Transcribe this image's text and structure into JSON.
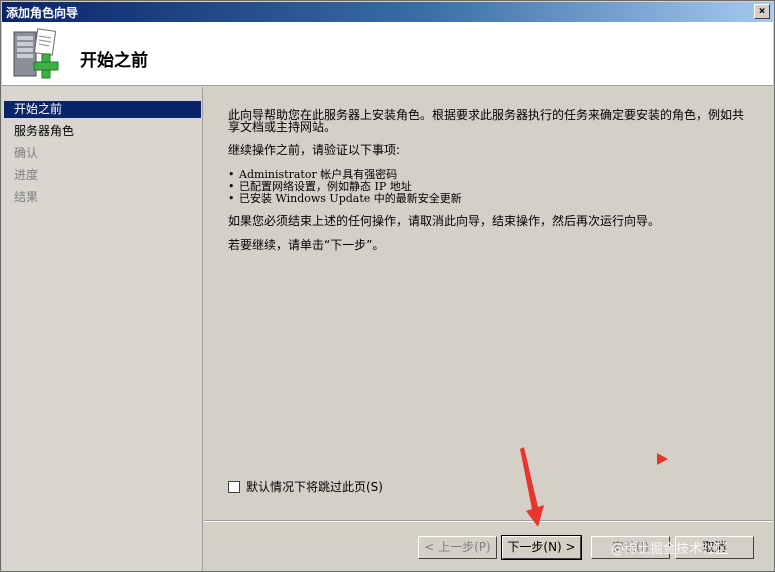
{
  "window": {
    "title": "添加角色向导",
    "close_label": "×"
  },
  "header": {
    "page_title": "开始之前"
  },
  "sidebar": {
    "items": [
      {
        "label": "开始之前",
        "state": "active"
      },
      {
        "label": "服务器角色",
        "state": "enabled"
      },
      {
        "label": "确认",
        "state": "disabled"
      },
      {
        "label": "进度",
        "state": "disabled"
      },
      {
        "label": "结果",
        "state": "disabled"
      }
    ]
  },
  "content": {
    "intro_line1": "此向导帮助您在此服务器上安装角色。根据要求此服务器执行的任务来确定要安装的角色，例如共",
    "intro_line2": "享文档或主持网站。",
    "verify_heading": "继续操作之前，请验证以下事项:",
    "bullets": [
      "Administrator 帐户具有强密码",
      "已配置网络设置，例如静态 IP 地址",
      "已安装 Windows Update 中的最新安全更新"
    ],
    "cancel_note": "如果您必须结束上述的任何操作，请取消此向导，结束操作，然后再次运行向导。",
    "continue_note": "若要继续，请单击“下一步”。",
    "bullet_glyph": "•"
  },
  "skip_checkbox": {
    "label": "默认情况下将跳过此页(S)",
    "checked": false
  },
  "buttons": {
    "back": "< 上一步(P)",
    "next": "下一步(N) >",
    "install": "安装(I)",
    "cancel": "取消"
  },
  "watermark": "@稀土掘金技术社区",
  "colors": {
    "title_start": "#0a246a",
    "title_end": "#a6caf0",
    "selected_bg": "#0a246a",
    "annotation": "#e8362d"
  }
}
